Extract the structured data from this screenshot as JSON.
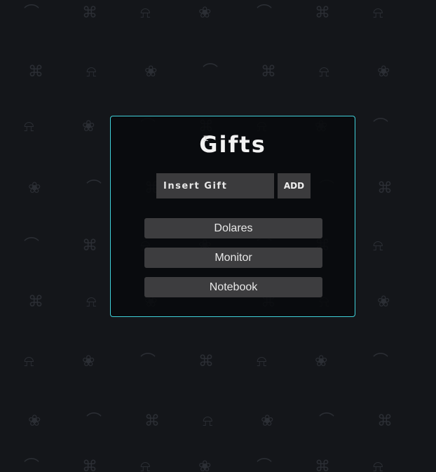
{
  "app": {
    "title": "Gifts"
  },
  "form": {
    "input_placeholder": "Insert Gift",
    "input_value": "",
    "add_label": "ADD"
  },
  "gifts": [
    {
      "label": "Dolares"
    },
    {
      "label": "Monitor"
    },
    {
      "label": "Notebook"
    }
  ],
  "colors": {
    "background": "#14161a",
    "card_border": "#3fd1d9",
    "card_background": "#080a0d",
    "control_background": "#3b3b3d",
    "text": "#f2f2f2"
  },
  "icons": {
    "background_pattern": [
      "candy-cane-icon",
      "gift-box-icon",
      "bell-icon",
      "bow-icon"
    ],
    "text_cursor": "i-beam-cursor-icon"
  }
}
